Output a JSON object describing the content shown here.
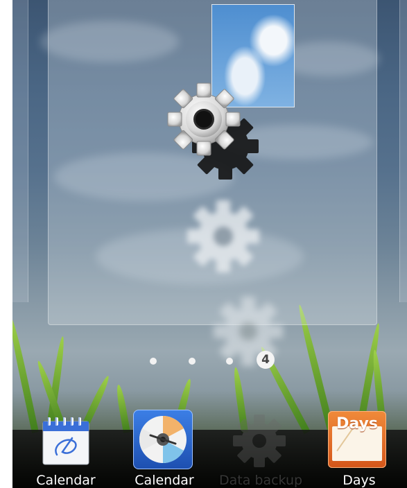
{
  "home": {
    "page_indicator": {
      "current_page": "4",
      "total_pages": 4
    }
  },
  "dock": {
    "apps": [
      {
        "label": "Calendar",
        "icon": "calendar-icon"
      },
      {
        "label": "Calendar",
        "icon": "disc-icon"
      },
      {
        "label": "Data backup",
        "icon": "gear-icon"
      },
      {
        "label": "Days",
        "icon": "days-icon",
        "icon_text": "Days"
      }
    ]
  },
  "colors": {
    "accent": "#e26b1e",
    "dock": "#111111"
  }
}
